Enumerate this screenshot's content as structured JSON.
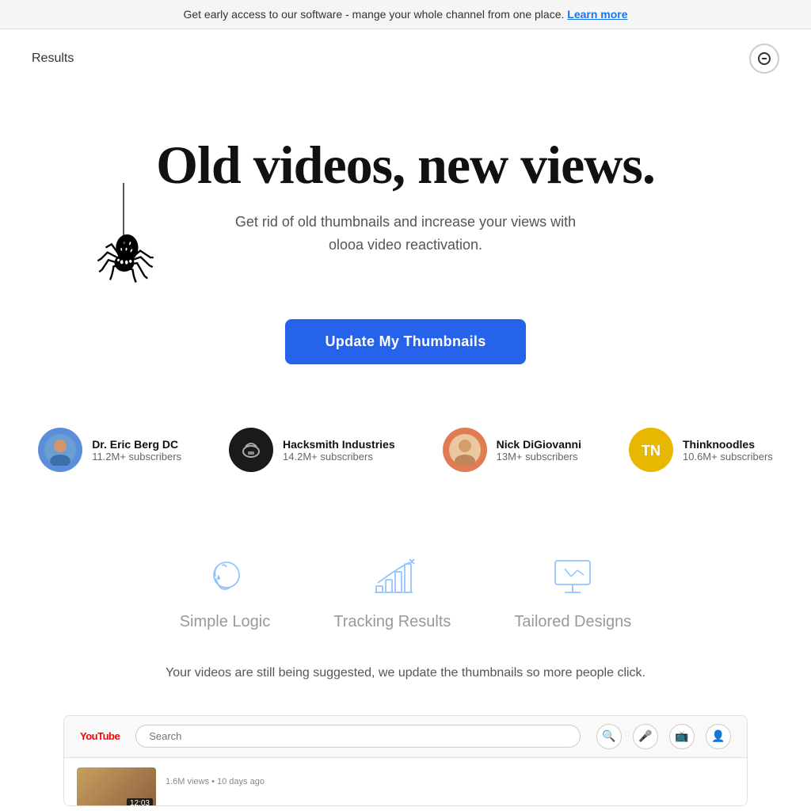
{
  "banner": {
    "text": "Get early access to our software - mange your whole channel from one place.",
    "link_text": "Learn more"
  },
  "nav": {
    "results_label": "Results",
    "icon_label": "menu"
  },
  "hero": {
    "title": "Old videos, new views.",
    "subtitle_line1": "Get rid of old thumbnails and increase your views with",
    "subtitle_line2": "olooa video reactivation."
  },
  "cta": {
    "button_label": "Update My Thumbnails"
  },
  "channels": [
    {
      "name": "Dr. Eric Berg DC",
      "subs": "11.2M+ subscribers",
      "emoji": "👨"
    },
    {
      "name": "Hacksmith Industries",
      "subs": "14.2M+ subscribers",
      "emoji": "⚒"
    },
    {
      "name": "Nick DiGiovanni",
      "subs": "13M+ subscribers",
      "emoji": "👱"
    },
    {
      "name": "Thinknoodles",
      "subs": "10.6M+ subscribers",
      "emoji": "🎮"
    }
  ],
  "features": [
    {
      "id": "simple-logic",
      "label": "Simple Logic",
      "icon": "brain"
    },
    {
      "id": "tracking-results",
      "label": "Tracking Results",
      "icon": "chart"
    },
    {
      "id": "tailored-designs",
      "label": "Tailored Designs",
      "icon": "monitor"
    }
  ],
  "description": "Your videos are still being suggested, we update the thumbnails so more people click.",
  "youtube_preview": {
    "logo": "YouTube",
    "search_placeholder": "Search",
    "views": "1.6M views",
    "time_ago": "10 days ago",
    "duration": "12:03"
  },
  "colors": {
    "cta_blue": "#2563eb",
    "icon_blue": "#93c5fd",
    "text_dark": "#111111",
    "text_gray": "#555555"
  }
}
